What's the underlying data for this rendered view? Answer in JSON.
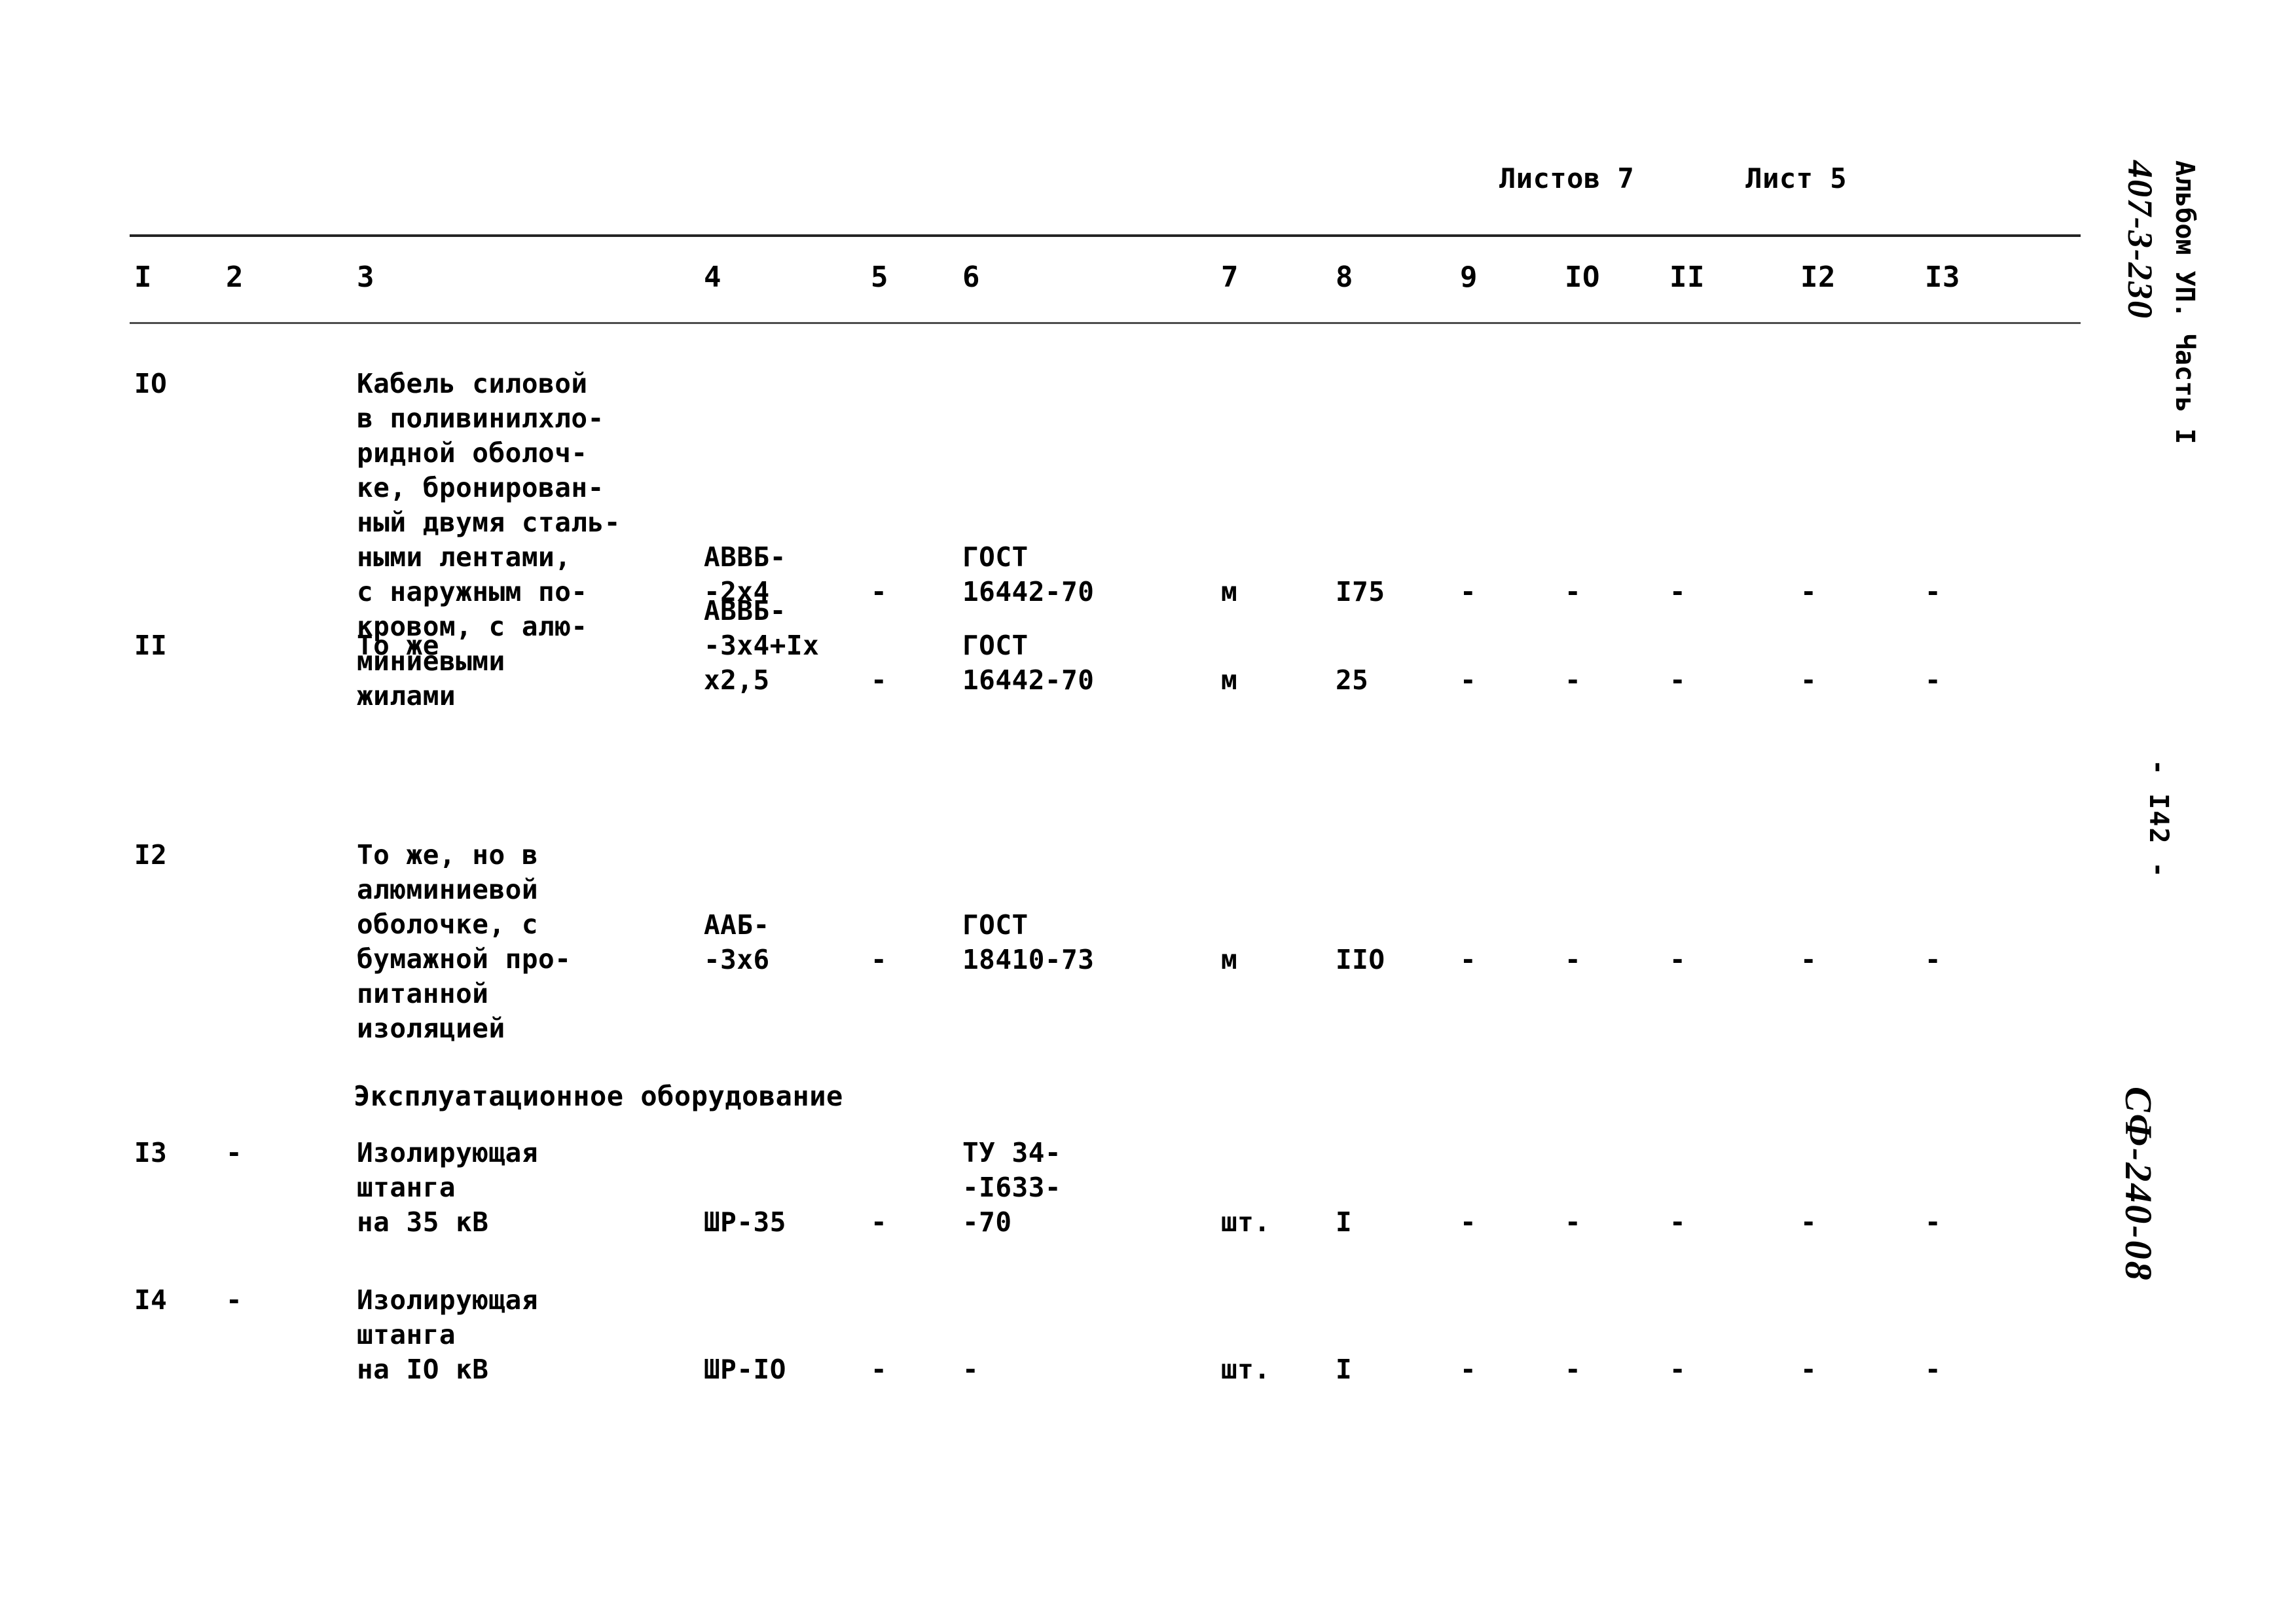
{
  "folio": {
    "sheets_total_label": "Листов 7",
    "sheet_label": "Лист 5"
  },
  "margin": {
    "drawing_code": "407-3-230",
    "album": "Альбом УП. Часть I",
    "page_number": "- I42 -",
    "archive_code": "СФ-240-08"
  },
  "table": {
    "column_numbers": [
      "I",
      "2",
      "3",
      "4",
      "5",
      "6",
      "7",
      "8",
      "9",
      "IO",
      "II",
      "I2",
      "I3"
    ],
    "section_heading": "Эксплуатационное оборудование",
    "rows": [
      {
        "num": "IO",
        "col2": "",
        "description": "Кабель силовой\nв поливинилхло-\nридной оболоч-\nке, бронирован-\nный двумя сталь-\nными лентами,\nс наружным по-\nкровом, с алю-\nминиевыми\nжилами",
        "type": "АВВБ-\n-2х4",
        "col5": "-",
        "standard": "ГОСТ\n16442-70",
        "unit": "м",
        "qty": "I75",
        "c9": "-",
        "c10": "-",
        "c11": "-",
        "c12": "-",
        "c13": "-"
      },
      {
        "num": "II",
        "col2": "",
        "description": "То же",
        "type": "АВВБ-\n-3х4+Iх\nх2,5",
        "col5": "-",
        "standard": "ГОСТ\n16442-70",
        "unit": "м",
        "qty": "25",
        "c9": "-",
        "c10": "-",
        "c11": "-",
        "c12": "-",
        "c13": "-"
      },
      {
        "num": "I2",
        "col2": "",
        "description": "То же, но в\nалюминиевой\nоболочке, с\nбумажной про-\nпитанной\nизоляцией",
        "type": "ААБ-\n-3х6",
        "col5": "-",
        "standard": "ГОСТ\n18410-73",
        "unit": "м",
        "qty": "IIO",
        "c9": "-",
        "c10": "-",
        "c11": "-",
        "c12": "-",
        "c13": "-"
      },
      {
        "num": "I3",
        "col2": "-",
        "description": "Изолирующая\nштанга\nна 35 кВ",
        "type": "ШР-35",
        "col5": "-",
        "standard": "ТУ 34-\n-I633-\n-70",
        "unit": "шт.",
        "qty": "I",
        "c9": "-",
        "c10": "-",
        "c11": "-",
        "c12": "-",
        "c13": "-"
      },
      {
        "num": "I4",
        "col2": "-",
        "description": "Изолирующая\nштанга\nна IO кВ",
        "type": "ШР-IO",
        "col5": "-",
        "standard": "-",
        "unit": "шт.",
        "qty": "I",
        "c9": "-",
        "c10": "-",
        "c11": "-",
        "c12": "-",
        "c13": "-"
      }
    ]
  }
}
